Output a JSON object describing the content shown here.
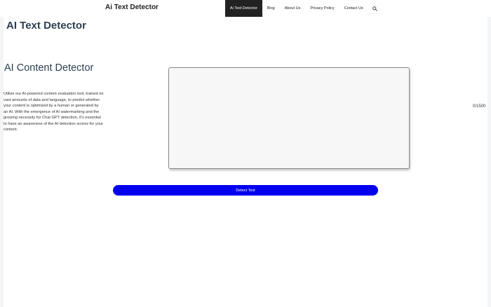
{
  "header": {
    "brand": "Ai Text Detector",
    "nav": {
      "items": [
        {
          "label": "Ai Text Detector",
          "active": true
        },
        {
          "label": "Blog"
        },
        {
          "label": "About Us"
        },
        {
          "label": "Privacy Policy"
        },
        {
          "label": "Contact Us"
        }
      ],
      "search_icon": "search-icon"
    }
  },
  "main": {
    "page_title": "AI Text Detector",
    "section_title": "AI Content Detector",
    "description": "Utilize our AI-powered content evaluation tool, trained on vast amounts of data and language, to predict whether your content is optimized by a human or generated by an AI. With the emergence of AI watermarking and the growing necessity for Chat GPT detection, it's essential to have an awareness of the AI detection scores for your content.",
    "text_input": {
      "value": "",
      "placeholder": ""
    },
    "char_count": "0/1500",
    "detect_button": "Detect Text"
  },
  "colors": {
    "nav_active_bg": "#222222",
    "heading": "#2c3e50",
    "button": "#0000ee"
  }
}
